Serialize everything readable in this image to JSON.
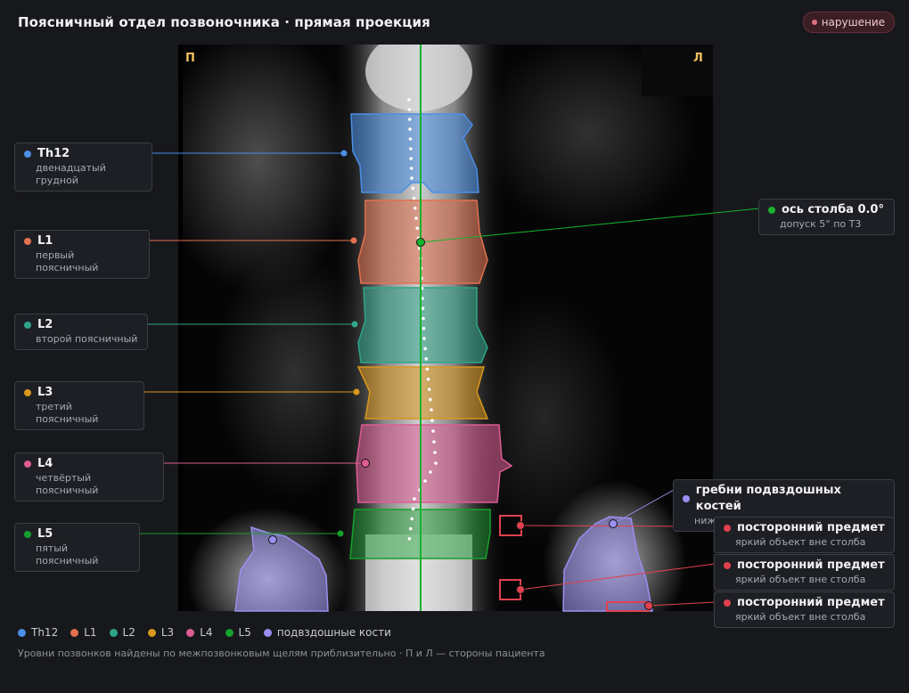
{
  "header": {
    "title": "Поясничный отдел позвоночника · прямая проекция",
    "badge": "нарушение"
  },
  "image": {
    "side_left": "П",
    "side_right": "Л"
  },
  "vertebrae": [
    {
      "id": "th12",
      "label": "Th12",
      "sub": "двенадцатый грудной",
      "color": "#4a8fe7"
    },
    {
      "id": "l1",
      "label": "L1",
      "sub": "первый поясничный",
      "color": "#e2714f"
    },
    {
      "id": "l2",
      "label": "L2",
      "sub": "второй поясничный",
      "color": "#2fa58a"
    },
    {
      "id": "l3",
      "label": "L3",
      "sub": "третий поясничный",
      "color": "#d9981c"
    },
    {
      "id": "l4",
      "label": "L4",
      "sub": "четвёртый поясничный",
      "color": "#de5c93"
    },
    {
      "id": "l5",
      "label": "L5",
      "sub": "пятый поясничный",
      "color": "#16a02e"
    }
  ],
  "axis": {
    "label": "ось столба 0.0°",
    "sub": "допуск 5° по Т3",
    "color": "#17b32d"
  },
  "iliac": {
    "label": "гребни подвздошных костей",
    "sub": "нижняя граница охвата",
    "color": "#9a8ff0"
  },
  "foreign": [
    {
      "label": "посторонний предмет",
      "sub": "яркий объект вне столба",
      "color": "#e0414f"
    },
    {
      "label": "посторонний предмет",
      "sub": "яркий объект вне столба",
      "color": "#e0414f"
    },
    {
      "label": "посторонний предмет",
      "sub": "яркий объект вне столба",
      "color": "#e0414f"
    }
  ],
  "legend": [
    {
      "label": "Th12",
      "color": "#4a8fe7"
    },
    {
      "label": "L1",
      "color": "#e2714f"
    },
    {
      "label": "L2",
      "color": "#2fa58a"
    },
    {
      "label": "L3",
      "color": "#d9981c"
    },
    {
      "label": "L4",
      "color": "#de5c93"
    },
    {
      "label": "L5",
      "color": "#16a02e"
    },
    {
      "label": "подвздошные кости",
      "color": "#9a8ff0"
    }
  ],
  "footnote": "Уровни позвонков найдены по межпозвонковым щелям приблизительно · П и Л — стороны пациента"
}
